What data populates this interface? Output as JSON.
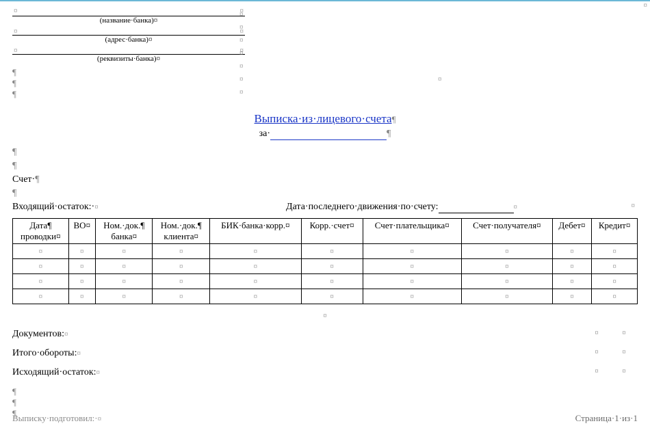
{
  "marks": {
    "box": "¤",
    "pil": "¶",
    "dot": "·"
  },
  "bank": {
    "name_caption": "(название·банка)¤",
    "addr_caption": "(адрес·банка)¤",
    "req_caption": "(реквизиты·банка)¤"
  },
  "title": "Выписка·из·лицевого·счета",
  "za_label": "за·",
  "labels": {
    "schet": "Счет·",
    "incoming": "Входящий·остаток:·",
    "last_move": "Дата·последнего·движения·по·счету:",
    "docs": "Документов:",
    "turnover": "Итого·обороты:",
    "outgoing": "Исходящий·остаток:",
    "prepared": "Выписку·подготовил:·",
    "page": "Страница·1·из·1"
  },
  "table": {
    "headers": [
      "Дата¶\nпроводки¤",
      "ВО¤",
      "Ном.·док.¶\nбанка¤",
      "Ном.·док.¶\nклиента¤",
      "БИК·банка·корр.¤",
      "Корр.·счет¤",
      "Счет·плательщика¤",
      "Счет·получателя¤",
      "Дебет¤",
      "Кредит¤"
    ],
    "rows": 4
  }
}
